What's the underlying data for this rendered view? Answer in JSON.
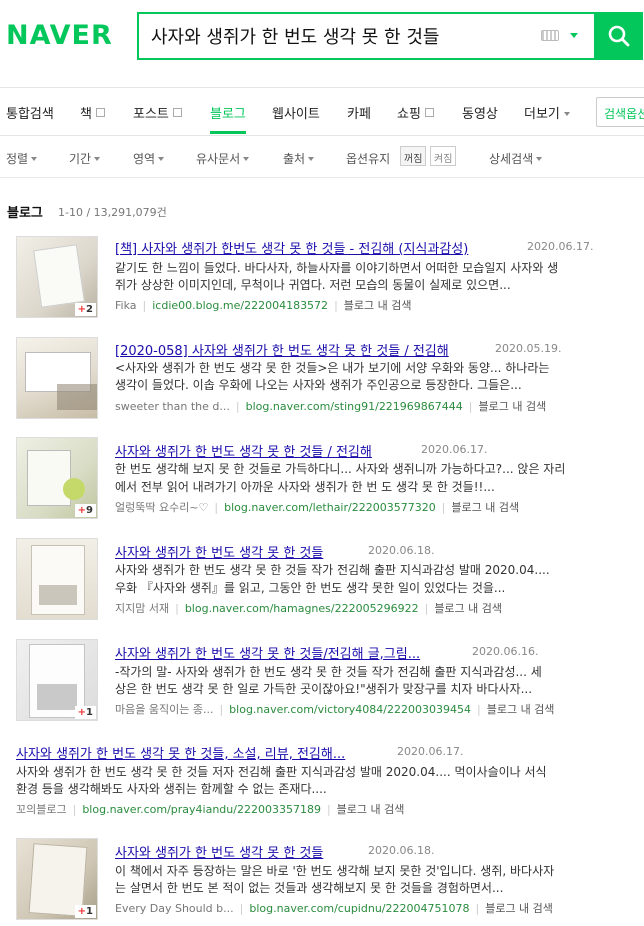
{
  "header": {
    "logo": "NAVER",
    "search_value": "사자와 생쥐가 한 번도 생각 못 한 것들"
  },
  "tabs": [
    {
      "label": "통합검색"
    },
    {
      "label": "책"
    },
    {
      "label": "포스트"
    },
    {
      "label": "블로그",
      "active": true
    },
    {
      "label": "웹사이트"
    },
    {
      "label": "카페"
    },
    {
      "label": "쇼핑"
    },
    {
      "label": "동영상"
    },
    {
      "label": "더보기"
    }
  ],
  "search_options_label": "검색옵션",
  "filters": {
    "sort": "정렬",
    "period": "기간",
    "area": "영역",
    "similar": "유사문서",
    "source": "출처",
    "keep_options": "옵션유지",
    "toggle_off": "꺼짐",
    "toggle_on": "켜짐",
    "detail": "상세검색"
  },
  "section": {
    "title": "블로그",
    "count": "1-10 / 13,291,079건"
  },
  "results": [
    {
      "title": "[책] 사자와 생쥐가 한번도 생각 못 한 것들 - 전김해 (지식과감성)",
      "date": "2020.06.17.",
      "desc1": "같기도 한 느낌이 들었다. 바다사자, 하늘사자를 이야기하면서 어떠한 모습일지 사자와 생",
      "desc2": "쥐가 상상한 이미지인데, 무척이나 귀엽다. 저런 모습의 동물이 실제로 있으면...",
      "author": "Fika",
      "url": "icdie00.blog.me/222004183572",
      "inblog": "블로그 내 검색",
      "badge": "2"
    },
    {
      "title": "[2020-058] 사자와 생쥐가 한 번도 생각 못 한 것들 / 전김해",
      "date": "2020.05.19.",
      "desc1": "<사자와 생쥐가 한 번도 생각 못 한 것들>은 내가 보기에 서양 우화와 동양... 하나라는",
      "desc2": "생각이 들었다. 이솝 우화에 나오는 사자와 생쥐가 주인공으로 등장한다. 그들은...",
      "author": "sweeter than the d...",
      "url": "blog.naver.com/sting91/221969867444",
      "inblog": "블로그 내 검색",
      "badge": ""
    },
    {
      "title": "사자와 생쥐가 한 번도 생각 못 한 것들 / 전김해",
      "date": "2020.06.17.",
      "desc1": "한 번도 생각해 보지 못 한 것들로 가득하다니... 사자와 생쥐니까 가능하다고?... 앉은 자리",
      "desc2": "에서 전부 읽어 내려가기 아까운 사자와 생쥐가 한 번 도 생각 못 한 것들!!...",
      "author": "얼렁뚝딱 요수리~♡",
      "url": "blog.naver.com/lethair/222003577320",
      "inblog": "블로그 내 검색",
      "badge": "9"
    },
    {
      "title": "사자와 생쥐가 한 번도 생각 못 한 것들",
      "date": "2020.06.18.",
      "desc1": "사자와 생쥐가 한 번도 생각 못 한 것들 작가 전김해 출판 지식과감성 발매 2020.04....",
      "desc2": "우화 『사자와 생쥐』를 읽고, 그동안 한 번도 생각 못한 일이 있었다는 것을...",
      "author": "지지맘 서재",
      "url": "blog.naver.com/hamagnes/222005296922",
      "inblog": "블로그 내 검색",
      "badge": ""
    },
    {
      "title": "사자와 생쥐가 한 번도 생각 못 한 것들/전김해 글,그림...",
      "date": "2020.06.16.",
      "desc1": "-작가의 말- 사자와 생쥐가 한 번도 생각 못 한 것들 작가 전김해 출판 지식과감성... 세",
      "desc2": "상은 한 번도 생각 못 한 일로 가득한 곳이잖아요!\"생쥐가 맞장구를 치자 바다사자...",
      "author": "마음을 움직이는 종...",
      "url": "blog.naver.com/victory4084/222003039454",
      "inblog": "블로그 내 검색",
      "badge": "1"
    },
    {
      "title": "사자와 생쥐가 한 번도 생각 못 한 것들, 소설, 리뷰, 전김해...",
      "date": "2020.06.17.",
      "desc1": "사자와 생쥐가 한 번도 생각 못 한 것들 저자 전김해 출판 지식과감성 발매 2020.04.... 먹이사슬이나 서식",
      "desc2": "환경 등을 생각해봐도 사자와 생쥐는 함께할 수 없는 존재다....",
      "author": "꼬의블로그",
      "url": "blog.naver.com/pray4iandu/222003357189",
      "inblog": "블로그 내 검색",
      "badge": ""
    },
    {
      "title": "사자와 생쥐가 한 번도 생각 못 한 것들",
      "date": "2020.06.18.",
      "desc1": "이 책에서 자주 등장하는 말은 바로 '한 번도 생각해 보지 못한 것'입니다. 생쥐, 바다사자",
      "desc2": "는 살면서 한 번도 본 적이 없는 것들과 생각해보지 못 한 것들을 경험하면서...",
      "author": "Every Day Should b...",
      "url": "blog.naver.com/cupidnu/222004751078",
      "inblog": "블로그 내 검색",
      "badge": "1"
    }
  ]
}
